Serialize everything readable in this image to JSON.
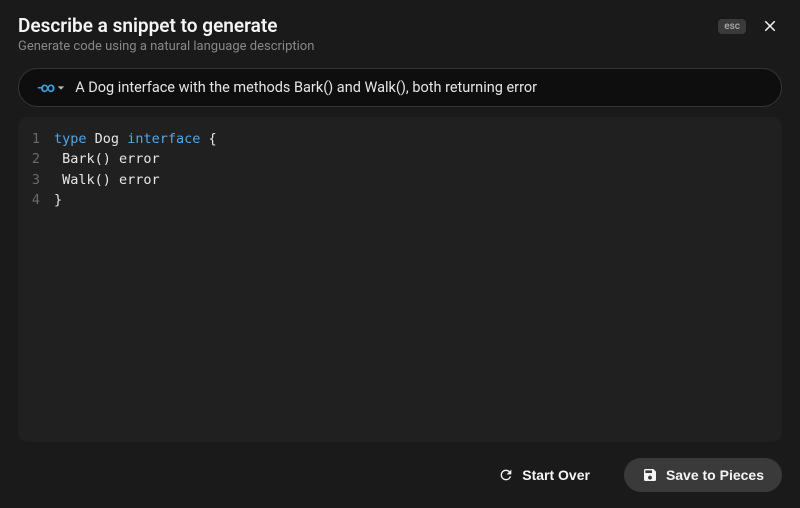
{
  "header": {
    "title": "Describe a snippet to generate",
    "subtitle": "Generate code using a natural language description",
    "esc_label": "esc"
  },
  "input": {
    "language_icon": "go-icon",
    "prompt": "A Dog interface with the methods Bark() and Walk(), both returning error"
  },
  "code": {
    "lines": [
      {
        "num": "1",
        "tokens": [
          {
            "t": "keyword",
            "v": "type"
          },
          {
            "t": "plain",
            "v": " "
          },
          {
            "t": "name",
            "v": "Dog"
          },
          {
            "t": "plain",
            "v": " "
          },
          {
            "t": "keyword",
            "v": "interface"
          },
          {
            "t": "plain",
            "v": " {"
          }
        ]
      },
      {
        "num": "2",
        "tokens": [
          {
            "t": "plain",
            "v": " Bark() error"
          }
        ]
      },
      {
        "num": "3",
        "tokens": [
          {
            "t": "plain",
            "v": " Walk() error"
          }
        ]
      },
      {
        "num": "4",
        "tokens": [
          {
            "t": "plain",
            "v": "}"
          }
        ]
      }
    ]
  },
  "footer": {
    "start_over": "Start Over",
    "save_label": "Save to Pieces"
  }
}
